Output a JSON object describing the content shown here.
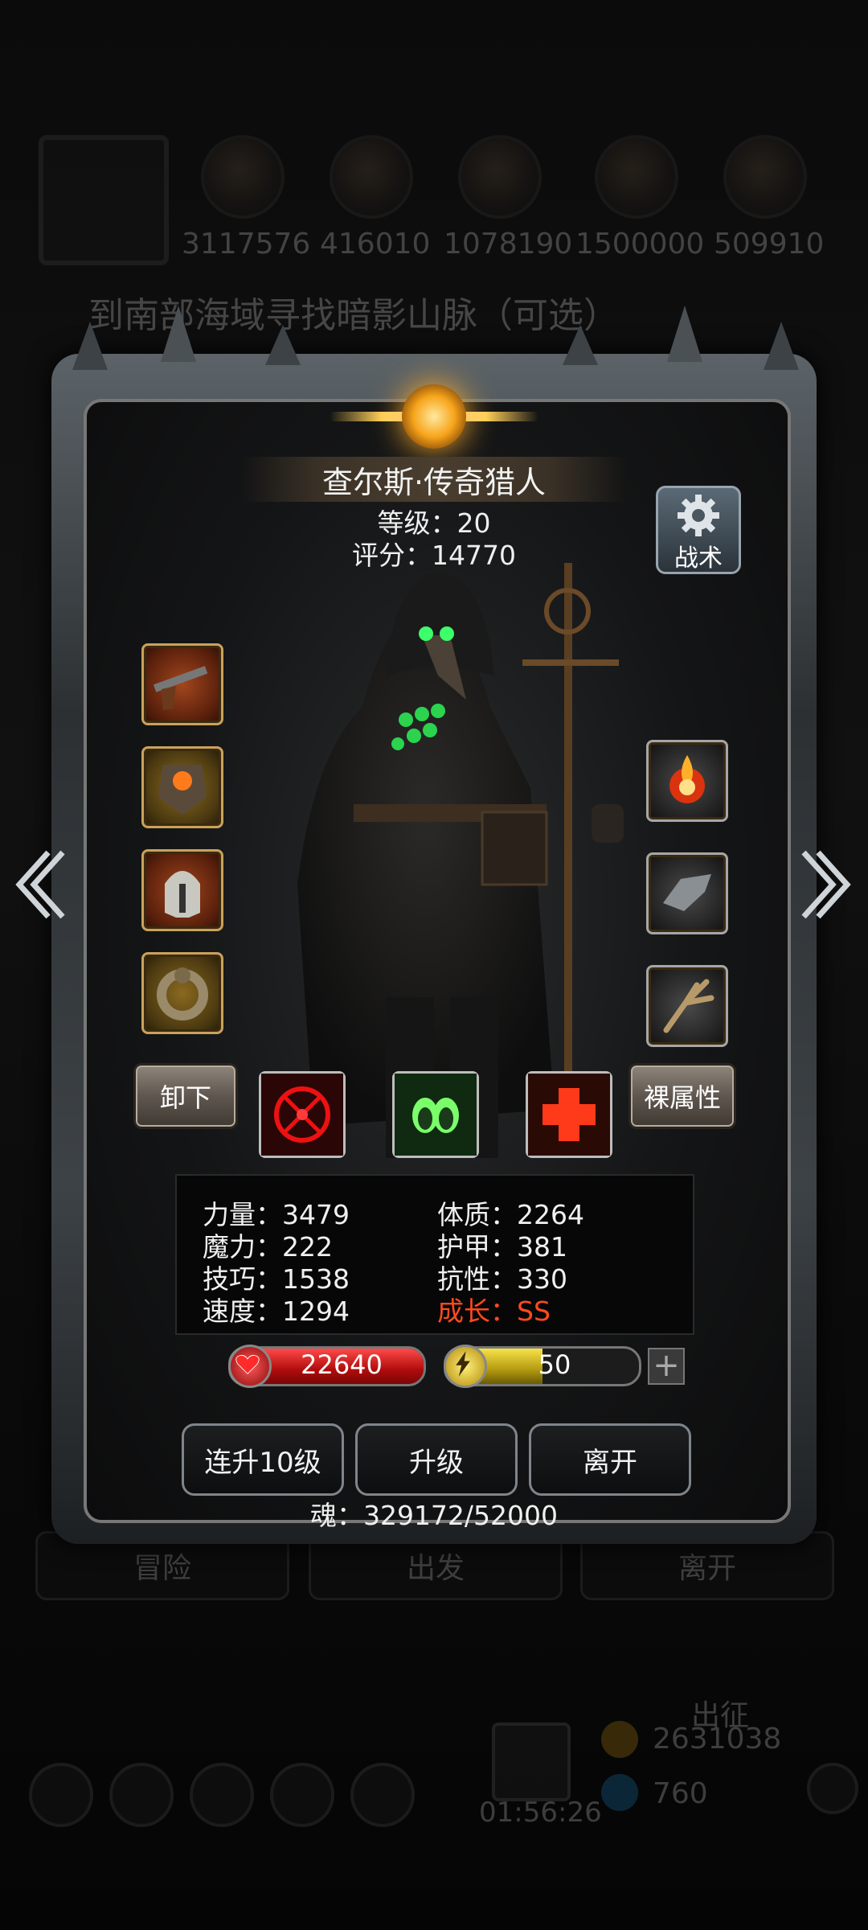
{
  "background": {
    "resources": [
      "3117576",
      "416010",
      "1078190",
      "1500000",
      "509910"
    ],
    "route_text": "到南部海域寻找暗影山脉（可选）",
    "bottom_buttons": [
      "冒险",
      "出发",
      "离开"
    ],
    "expedition_label": "出征",
    "currency_gold": "2631038",
    "currency_gem": "760",
    "timer": "01:56:26"
  },
  "panel": {
    "hero_name": "查尔斯·传奇猎人",
    "level_line": "等级：20",
    "score_line": "评分：14770",
    "tactics_label": "战术",
    "equipment_left": [
      "pistol",
      "chest-armor",
      "helmet",
      "ring"
    ],
    "equipment_right": [
      "fire-orb",
      "gauntlet",
      "claw"
    ],
    "unequip_label": "卸下",
    "base_attr_label": "裸属性",
    "skills": [
      "crosshair-skill",
      "green-mask-skill",
      "red-cross-skill"
    ],
    "stats": {
      "strength": "力量：3479",
      "magic": "魔力：222",
      "skill": "技巧：1538",
      "speed": "速度：1294",
      "constitution": "体质：2264",
      "armor": "护甲：381",
      "resistance": "抗性：330",
      "growth": "成长：SS"
    },
    "hp_value": "22640",
    "energy_value": "50",
    "plus_label": "+",
    "buttons": {
      "level10": "连升10级",
      "level": "升级",
      "leave": "离开"
    },
    "soul_line": "魂：329172/52000"
  },
  "colors": {
    "accent_gold": "#f7a51b",
    "hp_red": "#d11a1a",
    "energy_yellow": "#c9b21e",
    "growth_red": "#ff4a1e"
  }
}
